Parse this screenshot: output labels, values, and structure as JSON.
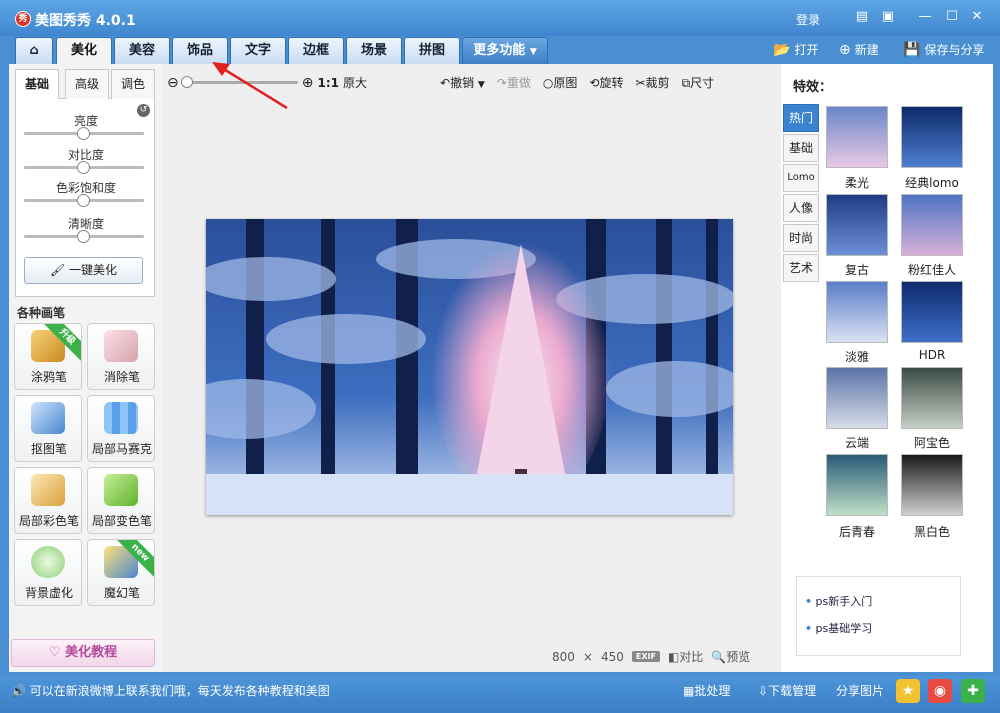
{
  "app": {
    "title": "美图秀秀 4.0.1",
    "logo_text": "秀"
  },
  "titlebar": {
    "login": "登录"
  },
  "tabs": [
    {
      "label": "美化",
      "active": true
    },
    {
      "label": "美容"
    },
    {
      "label": "饰品"
    },
    {
      "label": "文字"
    },
    {
      "label": "边框"
    },
    {
      "label": "场景"
    },
    {
      "label": "拼图"
    },
    {
      "label": "更多功能"
    }
  ],
  "toolbar_right": {
    "open": "打开",
    "new": "新建",
    "save": "保存与分享"
  },
  "left": {
    "subtabs": [
      "基础",
      "高级",
      "调色"
    ],
    "sliders": [
      "亮度",
      "对比度",
      "色彩饱和度",
      "清晰度"
    ],
    "one_key": "一键美化",
    "brushes_title": "各种画笔",
    "brushes": [
      {
        "label": "涂鸦笔",
        "badge": "升级"
      },
      {
        "label": "消除笔"
      },
      {
        "label": "抠图笔"
      },
      {
        "label": "局部马赛克"
      },
      {
        "label": "局部彩色笔"
      },
      {
        "label": "局部变色笔"
      },
      {
        "label": "背景虚化"
      },
      {
        "label": "魔幻笔",
        "badge": "new"
      }
    ],
    "tutorial": "美化教程"
  },
  "canvas": {
    "zoom_label": "1:1",
    "original_size": "原大",
    "tools": [
      "撤销",
      "重做",
      "原图",
      "旋转",
      "裁剪",
      "尺寸"
    ],
    "width": "800",
    "times": "×",
    "height": "450",
    "exif": "EXIF",
    "compare": "对比",
    "preview": "预览"
  },
  "effects": {
    "title": "特效：",
    "categories": [
      "热门",
      "基础",
      "Lomo",
      "人像",
      "时尚",
      "艺术"
    ],
    "items": [
      {
        "label": "柔光"
      },
      {
        "label": "经典lomo"
      },
      {
        "label": "复古"
      },
      {
        "label": "粉红佳人"
      },
      {
        "label": "淡雅"
      },
      {
        "label": "HDR"
      },
      {
        "label": "云端"
      },
      {
        "label": "阿宝色"
      },
      {
        "label": "后青春"
      },
      {
        "label": "黑白色"
      }
    ],
    "tips": [
      "ps新手入门",
      "ps基础学习"
    ]
  },
  "statusbar": {
    "news": "可以在新浪微博上联系我们哦，每天发布各种教程和美图",
    "batch": "批处理",
    "download": "下载管理",
    "share": "分享图片"
  },
  "colors": {
    "accent": "#3b83d0",
    "titlebar": "#4a8fd2"
  }
}
